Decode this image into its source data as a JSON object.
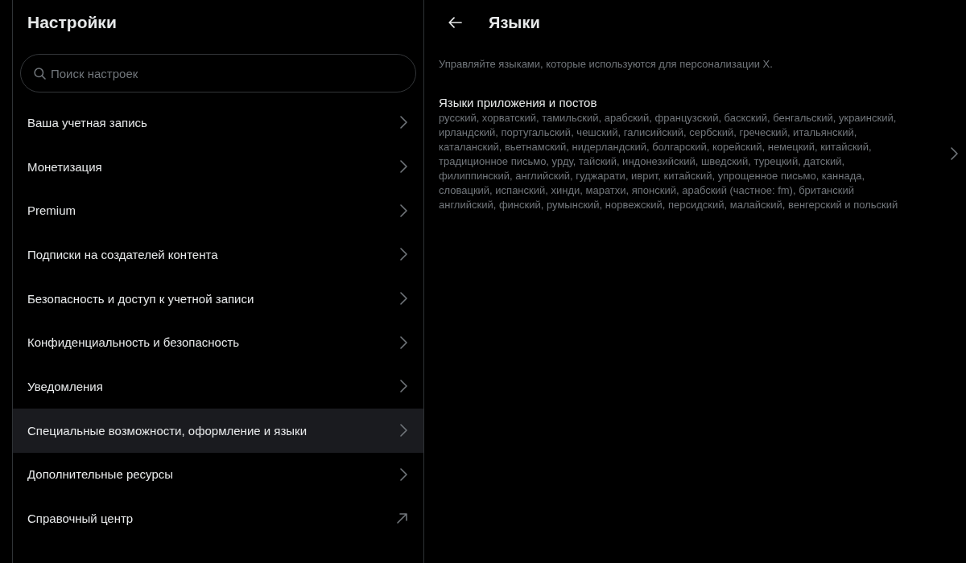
{
  "sidebar": {
    "title": "Настройки",
    "search": {
      "placeholder": "Поиск настроек"
    },
    "items": [
      {
        "label": "Ваша учетная запись",
        "kind": "chevron",
        "selected": false
      },
      {
        "label": "Монетизация",
        "kind": "chevron",
        "selected": false
      },
      {
        "label": "Premium",
        "kind": "chevron",
        "selected": false
      },
      {
        "label": "Подписки на создателей контента",
        "kind": "chevron",
        "selected": false
      },
      {
        "label": "Безопасность и доступ к учетной записи",
        "kind": "chevron",
        "selected": false
      },
      {
        "label": "Конфиденциальность и безопасность",
        "kind": "chevron",
        "selected": false
      },
      {
        "label": "Уведомления",
        "kind": "chevron",
        "selected": false
      },
      {
        "label": "Специальные возможности, оформление и языки",
        "kind": "chevron",
        "selected": true
      },
      {
        "label": "Дополнительные ресурсы",
        "kind": "chevron",
        "selected": false
      },
      {
        "label": "Справочный центр",
        "kind": "external",
        "selected": false
      }
    ]
  },
  "detail": {
    "title": "Языки",
    "description": "Управляйте языками, которые используются для персонализации X.",
    "rows": [
      {
        "title": "Языки приложения и постов",
        "value": "русский, хорватский, тамильский, арабский, французский, баскский, бенгальский, украинский, ирландский, португальский, чешский, галисийский, сербский, греческий, итальянский, каталанский, вьетнамский, нидерландский, болгарский, корейский, немецкий, китайский, традиционное письмо, урду, тайский, индонезийский, шведский, турецкий, датский, филиппинский, английский, гуджарати, иврит, китайский, упрощенное письмо, каннада, словацкий, испанский, хинди, маратхи, японский, арабский (частное: fm), британский английский, финский, румынский, норвежский, персидский, малайский, венгерский и польский"
      }
    ]
  }
}
